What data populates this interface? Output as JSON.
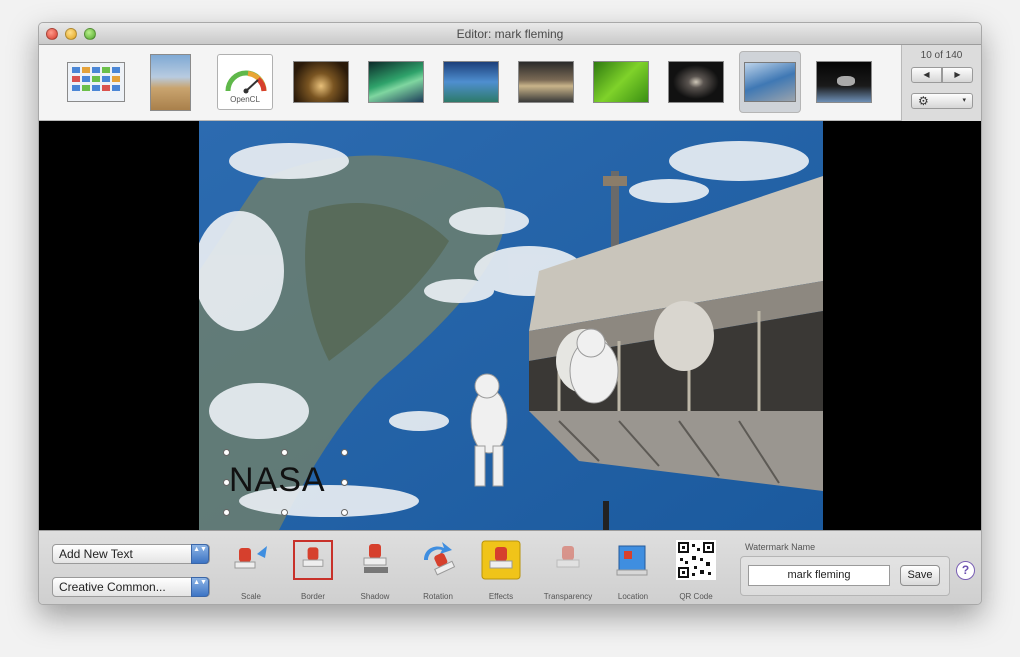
{
  "window": {
    "title": "Editor: mark fleming"
  },
  "strip": {
    "opencl_label": "OpenCL",
    "counter": "10 of 140",
    "prev_glyph": "◀",
    "next_glyph": "▶",
    "gear_glyph": "⚙",
    "gear_chevron": "▾"
  },
  "canvas": {
    "watermark_text": "NASA"
  },
  "bottom": {
    "add_text_popup": "Add New Text",
    "license_popup": "Creative Common...",
    "popup_arrows": "▲▼",
    "tools": [
      {
        "label": "Scale",
        "icon": "scale-stamp-icon"
      },
      {
        "label": "Border",
        "icon": "border-stamp-icon"
      },
      {
        "label": "Shadow",
        "icon": "shadow-stamp-icon"
      },
      {
        "label": "Rotation",
        "icon": "rotation-stamp-icon"
      },
      {
        "label": "Effects",
        "icon": "effects-stamp-icon"
      },
      {
        "label": "Transparency",
        "icon": "transparency-stamp-icon"
      },
      {
        "label": "Location",
        "icon": "location-icon"
      },
      {
        "label": "QR Code",
        "icon": "qr-code-icon"
      }
    ],
    "watermark_name_label": "Watermark Name",
    "watermark_name_value": "mark fleming",
    "save_label": "Save",
    "help_glyph": "?"
  },
  "colors": {
    "active_border": "#c8312a",
    "help_accent": "#6b4fb0"
  }
}
